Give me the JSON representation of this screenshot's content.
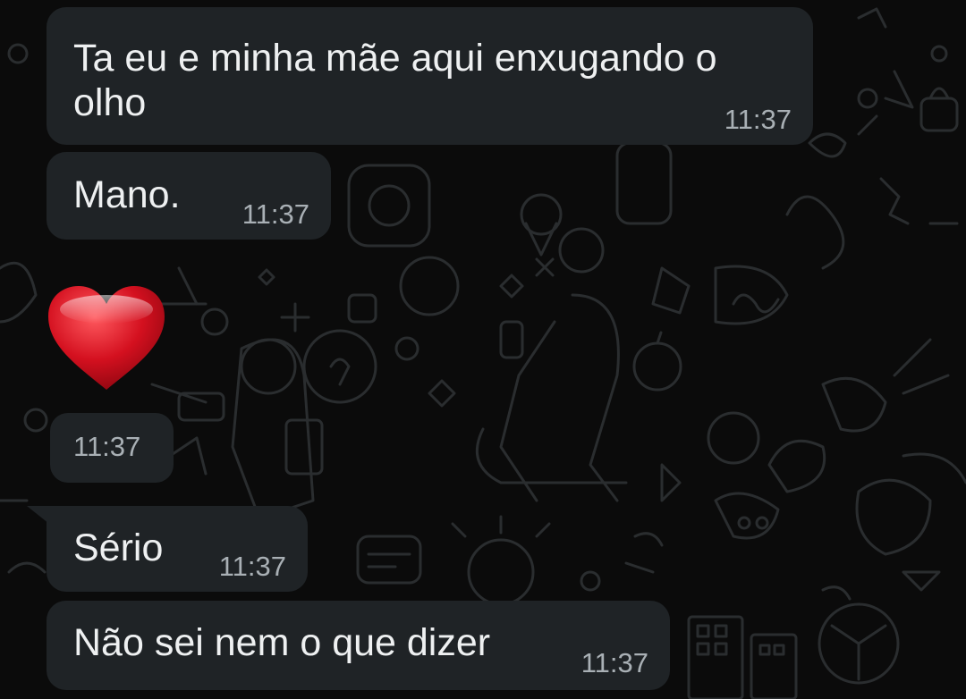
{
  "conversation": {
    "messages": [
      {
        "text": "Ta eu e minha mãe aqui enxugando o\nolho",
        "time": "11:37"
      },
      {
        "text": "Mano.",
        "time": "11:37"
      },
      {
        "emoji": "heart",
        "time": "11:37"
      },
      {
        "text": "Sério",
        "time": "11:37"
      },
      {
        "text": "Não sei nem o que dizer",
        "time": "11:37"
      }
    ]
  },
  "colors": {
    "background": "#0b0b0b",
    "bubble": "#1f2326",
    "text": "#eef0f1",
    "timestamp": "#a9b0b5",
    "heart": "#d4101f"
  },
  "icons": {
    "heart_emoji": "red-heart-icon"
  }
}
